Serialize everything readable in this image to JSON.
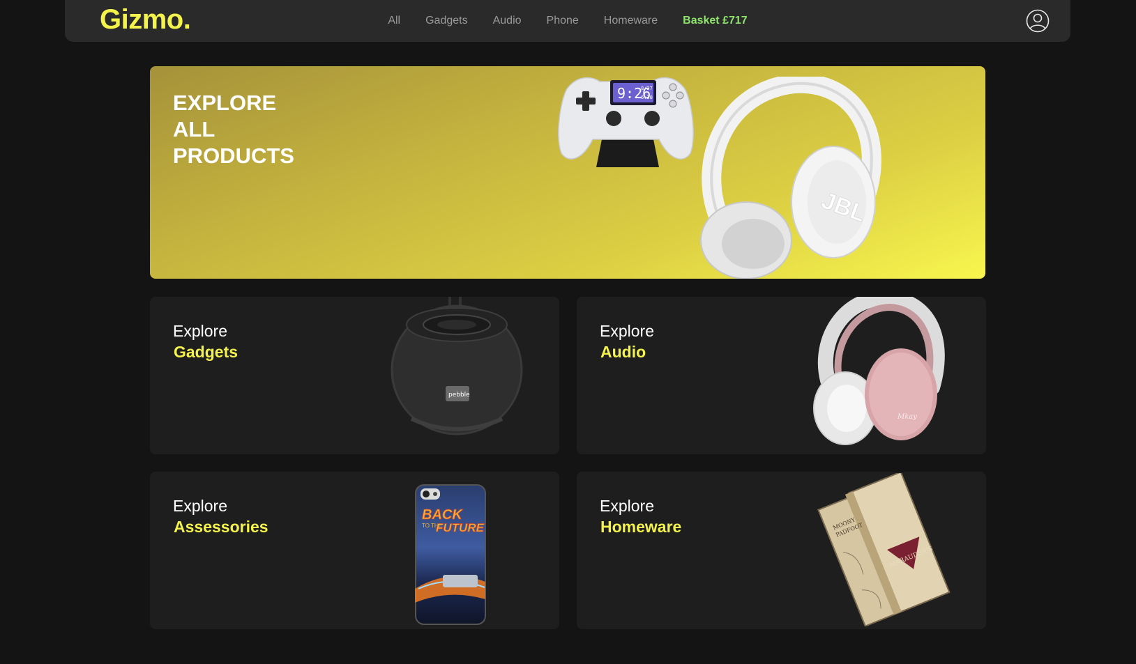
{
  "brand": {
    "logo": "Gizmo."
  },
  "nav": {
    "links": [
      "All",
      "Gadgets",
      "Audio",
      "Phone",
      "Homeware"
    ],
    "basket": "Basket £717"
  },
  "hero": {
    "lines": [
      "EXPLORE",
      "ALL",
      "PRODUCTS"
    ],
    "clock_time": "9:26",
    "clock_small_1": "8/27",
    "clock_small_2": "6:30",
    "headphone_brand": "JBL"
  },
  "cards": [
    {
      "kicker": "Explore",
      "category": "Gadgets",
      "product_label": "pebble"
    },
    {
      "kicker": "Explore",
      "category": "Audio",
      "product_label": "Mkay"
    },
    {
      "kicker": "Explore",
      "category": "Assessories",
      "product_label_1": "BACK",
      "product_label_2": "TO THE",
      "product_label_3": "FUTURE"
    },
    {
      "kicker": "Explore",
      "category": "Homeware",
      "product_label": "MARAUDER'S"
    }
  ],
  "colors": {
    "accent": "#f4f34c",
    "basket": "#8de36b",
    "background": "#141414",
    "card": "#1e1e1e",
    "navbar": "#2a2a2a"
  }
}
